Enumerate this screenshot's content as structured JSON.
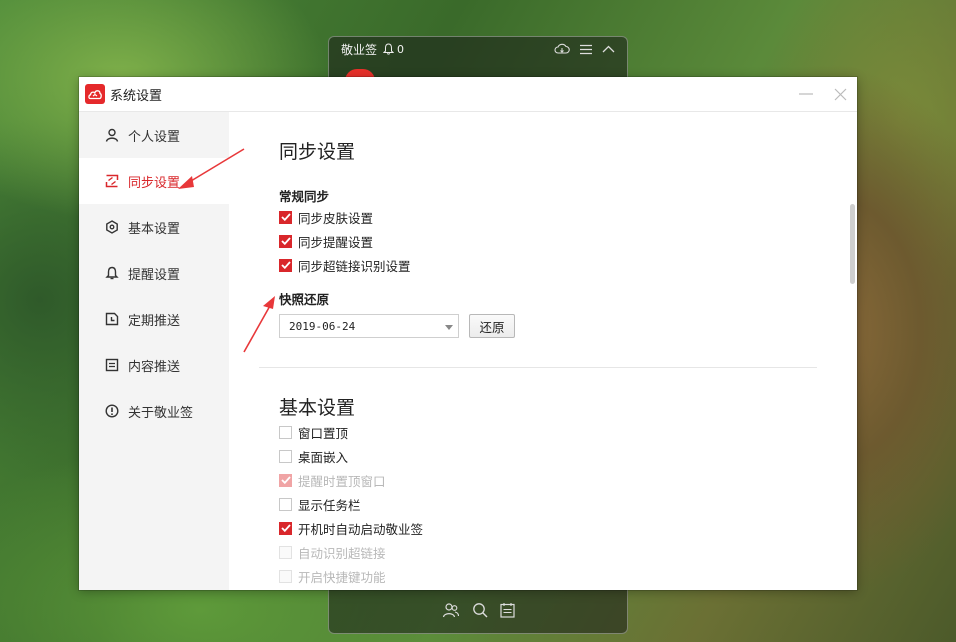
{
  "note_widget": {
    "title": "敬业签",
    "reminder_count": "0"
  },
  "dialog": {
    "title": "系统设置"
  },
  "sidebar": {
    "items": [
      {
        "label": "个人设置",
        "icon": "user-icon"
      },
      {
        "label": "同步设置",
        "icon": "sync-icon",
        "active": true
      },
      {
        "label": "基本设置",
        "icon": "gear-icon"
      },
      {
        "label": "提醒设置",
        "icon": "bell-icon"
      },
      {
        "label": "定期推送",
        "icon": "calendar-clock-icon"
      },
      {
        "label": "内容推送",
        "icon": "document-icon"
      },
      {
        "label": "关于敬业签",
        "icon": "info-icon"
      }
    ]
  },
  "sync": {
    "title": "同步设置",
    "regular_title": "常规同步",
    "options": [
      {
        "label": "同步皮肤设置",
        "checked": true
      },
      {
        "label": "同步提醒设置",
        "checked": true
      },
      {
        "label": "同步超链接识别设置",
        "checked": true
      }
    ],
    "snapshot_title": "快照还原",
    "snapshot_date": "2019-06-24",
    "restore_label": "还原"
  },
  "basic": {
    "title": "基本设置",
    "options": [
      {
        "label": "窗口置顶",
        "checked": false,
        "disabled": false
      },
      {
        "label": "桌面嵌入",
        "checked": false,
        "disabled": false
      },
      {
        "label": "提醒时置顶窗口",
        "checked": true,
        "disabled": true
      },
      {
        "label": "显示任务栏",
        "checked": false,
        "disabled": false
      },
      {
        "label": "开机时自动启动敬业签",
        "checked": true,
        "disabled": false
      },
      {
        "label": "自动识别超链接",
        "checked": false,
        "disabled": true
      },
      {
        "label": "开启快捷键功能",
        "checked": false,
        "disabled": true
      }
    ]
  },
  "colors": {
    "accent": "#d9272b",
    "annotation_arrow": "#e8383a"
  }
}
